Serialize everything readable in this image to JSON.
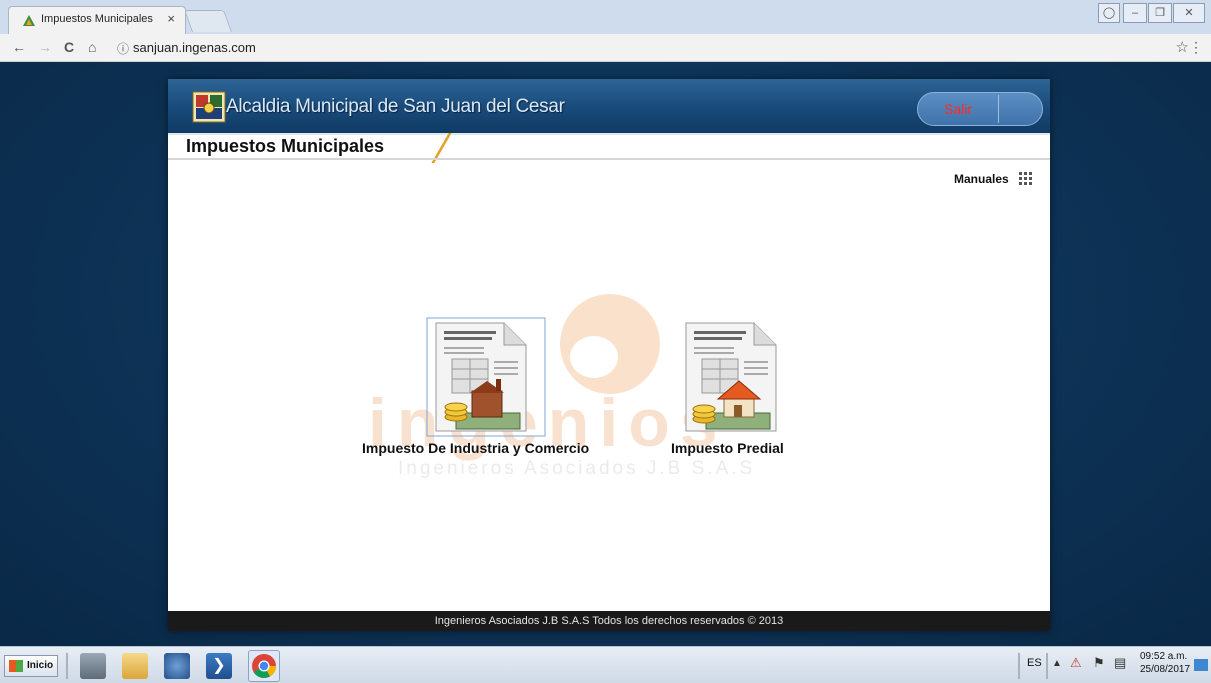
{
  "browser": {
    "tab_title": "Impuestos Municipales",
    "tab_close": "×",
    "url_info_icon": "ⓘ",
    "url": "sanjuan.ingenas.com",
    "back": "←",
    "forward": "→",
    "reload": "C",
    "home": "⌂",
    "star": "☆",
    "menu": "⋮",
    "window_controls": [
      "user-icon",
      "minimize-icon",
      "restore-icon",
      "close-icon"
    ]
  },
  "app": {
    "title": "Alcaldia Municipal de San Juan del Cesar",
    "logout_label": "Salir",
    "page_title": "Impuestos Municipales",
    "manuales_label": "Manuales",
    "watermark": {
      "text": "ingenios",
      "subtext": "Ingenieros  Asociados J.B S.A.S"
    },
    "tiles": [
      {
        "label": "Impuesto De Industria y Comercio",
        "icon": "document-factory-coins-icon"
      },
      {
        "label": "Impuesto Predial",
        "icon": "document-house-coins-icon"
      }
    ],
    "footer": "Ingenieros Asociados J.B S.A.S Todos los derechos reservados © 2013"
  },
  "taskbar": {
    "start_label": "Inicio",
    "apps": [
      "server-manager-icon",
      "file-explorer-icon",
      "virtualbox-icon",
      "powershell-icon",
      "chrome-icon"
    ],
    "language": "ES",
    "time": "09:52 a.m.",
    "date": "25/08/2017"
  },
  "colors": {
    "header_blue": "#1a4c7c",
    "accent_orange": "#e5a12b",
    "logout_text": "#ff2828",
    "footer_bg": "#1a1a1a"
  }
}
